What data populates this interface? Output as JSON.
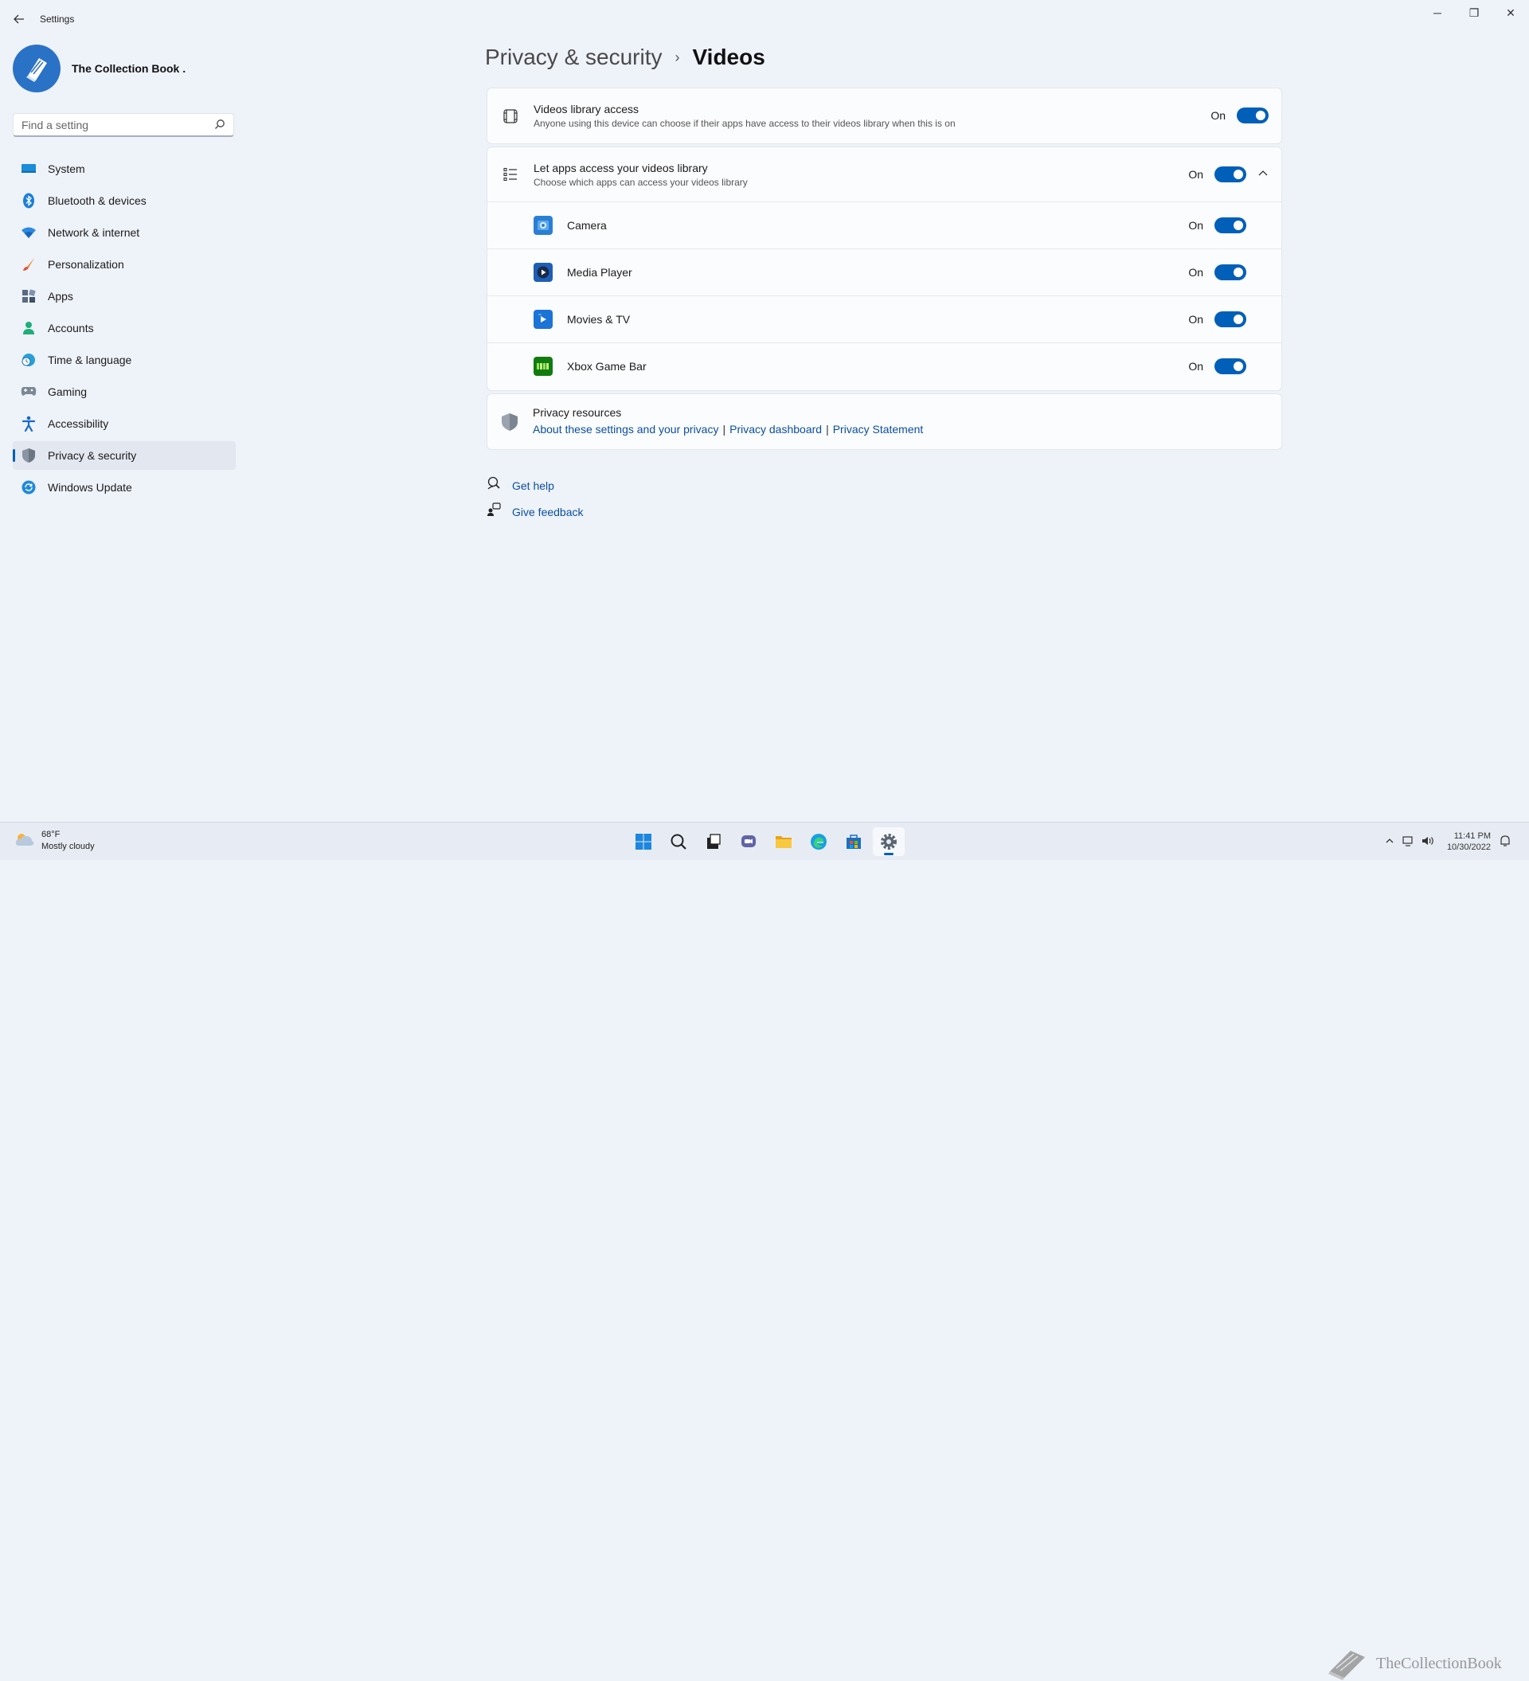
{
  "window": {
    "title": "Settings",
    "minimize_glyph": "─",
    "maximize_glyph": "❐",
    "close_glyph": "✕"
  },
  "profile": {
    "name": "The Collection Book ."
  },
  "search": {
    "placeholder": "Find a setting"
  },
  "sidebar": {
    "items": [
      {
        "label": "System",
        "icon": "system-icon"
      },
      {
        "label": "Bluetooth & devices",
        "icon": "bluetooth-icon"
      },
      {
        "label": "Network & internet",
        "icon": "wifi-icon"
      },
      {
        "label": "Personalization",
        "icon": "brush-icon"
      },
      {
        "label": "Apps",
        "icon": "apps-icon"
      },
      {
        "label": "Accounts",
        "icon": "person-icon"
      },
      {
        "label": "Time & language",
        "icon": "clock-globe-icon"
      },
      {
        "label": "Gaming",
        "icon": "gamepad-icon"
      },
      {
        "label": "Accessibility",
        "icon": "accessibility-icon"
      },
      {
        "label": "Privacy & security",
        "icon": "shield-icon",
        "active": true
      },
      {
        "label": "Windows Update",
        "icon": "update-icon"
      }
    ]
  },
  "breadcrumb": {
    "parent": "Privacy & security",
    "separator": "›",
    "current": "Videos"
  },
  "library_access": {
    "title": "Videos library access",
    "subtitle": "Anyone using this device can choose if their apps have access to their videos library when this is on",
    "state": "On"
  },
  "apps_access": {
    "title": "Let apps access your videos library",
    "subtitle": "Choose which apps can access your videos library",
    "state": "On",
    "apps": [
      {
        "label": "Camera",
        "state": "On",
        "icon": "camera-app-icon"
      },
      {
        "label": "Media Player",
        "state": "On",
        "icon": "media-player-app-icon"
      },
      {
        "label": "Movies & TV",
        "state": "On",
        "icon": "movies-tv-app-icon"
      },
      {
        "label": "Xbox Game Bar",
        "state": "On",
        "icon": "xbox-game-bar-app-icon"
      }
    ]
  },
  "privacy_resources": {
    "title": "Privacy resources",
    "links": [
      "About these settings and your privacy",
      "Privacy dashboard",
      "Privacy Statement"
    ],
    "separator": "|"
  },
  "help": {
    "get_help": "Get help",
    "give_feedback": "Give feedback"
  },
  "taskbar": {
    "weather_temp": "68°F",
    "weather_desc": "Mostly cloudy",
    "time": "11:41 PM",
    "date": "10/30/2022"
  },
  "watermark": {
    "text": "TheCollectionBook"
  },
  "colors": {
    "accent": "#005fb8",
    "link": "#0a4f9f",
    "background": "#eef2f9"
  }
}
